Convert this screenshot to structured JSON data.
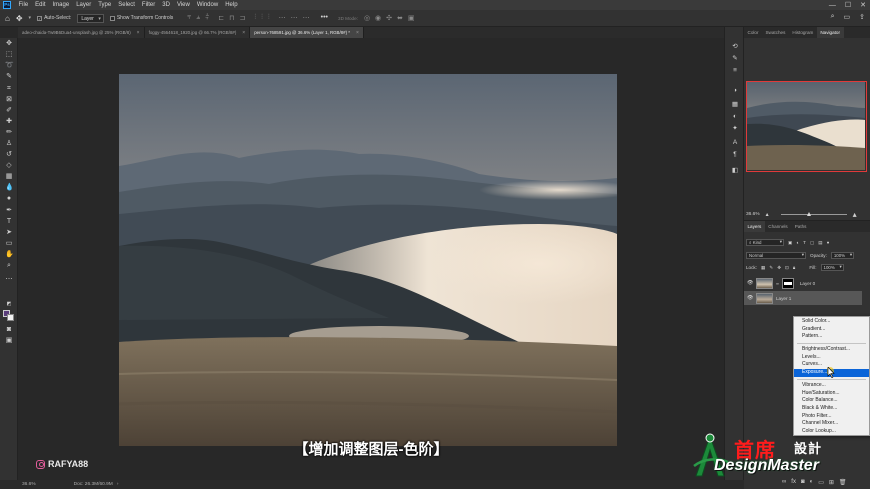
{
  "app": {
    "logo_text": "Ps"
  },
  "menubar": {
    "items": [
      "File",
      "Edit",
      "Image",
      "Layer",
      "Type",
      "Select",
      "Filter",
      "3D",
      "View",
      "Window",
      "Help"
    ],
    "window_controls": [
      "—",
      "☐",
      "✕"
    ]
  },
  "options_bar": {
    "auto_select_label": "Auto-Select:",
    "auto_select_value": "Layer",
    "show_transform_label": "Show Transform Controls",
    "mode_label": "3D Mode:"
  },
  "tabs": [
    {
      "label": "adeo-chaida-Tw9B6Dua4-unsplash.jpg @ 25% (RGB/8)",
      "active": false
    },
    {
      "label": "foggy-4564618_1920.jpg @ 66.7% (RGB/8#)",
      "active": false
    },
    {
      "label": "person-768591.jpg @ 36.6% (Layer 1, RGB/8#) *",
      "active": true
    }
  ],
  "canvas": {
    "subtitle": "【增加调整图层-色阶】",
    "watermark": "RAFYA88"
  },
  "statusbar": {
    "zoom": "36.6%",
    "doc": "Doc: 26.3M/60.9M"
  },
  "right_panel": {
    "top_tabs": [
      "Color",
      "Swatches",
      "Histogram",
      "Navigator"
    ],
    "active_top_tab": "Navigator",
    "zoom_value": "36.6%",
    "layer_tabs": [
      "Layers",
      "Channels",
      "Paths"
    ],
    "kind_label": "Kind",
    "blend_mode": "Normal",
    "opacity_label": "Opacity:",
    "opacity_value": "100%",
    "lock_label": "Lock:",
    "fill_label": "Fill:",
    "fill_value": "100%",
    "layers": [
      {
        "name": "Layer 0",
        "selected": false,
        "has_mask": true
      },
      {
        "name": "Layer 1",
        "selected": true,
        "has_mask": false
      }
    ]
  },
  "adjustment_menu": {
    "groups": [
      [
        "Solid Color...",
        "Gradient...",
        "Pattern..."
      ],
      [
        "Brightness/Contrast...",
        "Levels...",
        "Curves...",
        "Exposure..."
      ],
      [
        "Vibrance...",
        "Hue/Saturation...",
        "Color Balance...",
        "Black & White...",
        "Photo Filter...",
        "Channel Mixer...",
        "Color Lookup..."
      ]
    ],
    "highlighted": "Exposure..."
  },
  "logo": {
    "cn": "首席",
    "cn2": "設計",
    "en": "DesignMaster"
  },
  "colors": {
    "accent": "#0a64d8",
    "nav_frame": "#e03a3a",
    "fg_swatch": "#5a3d7a",
    "logo_red": "#ff1c1c"
  }
}
